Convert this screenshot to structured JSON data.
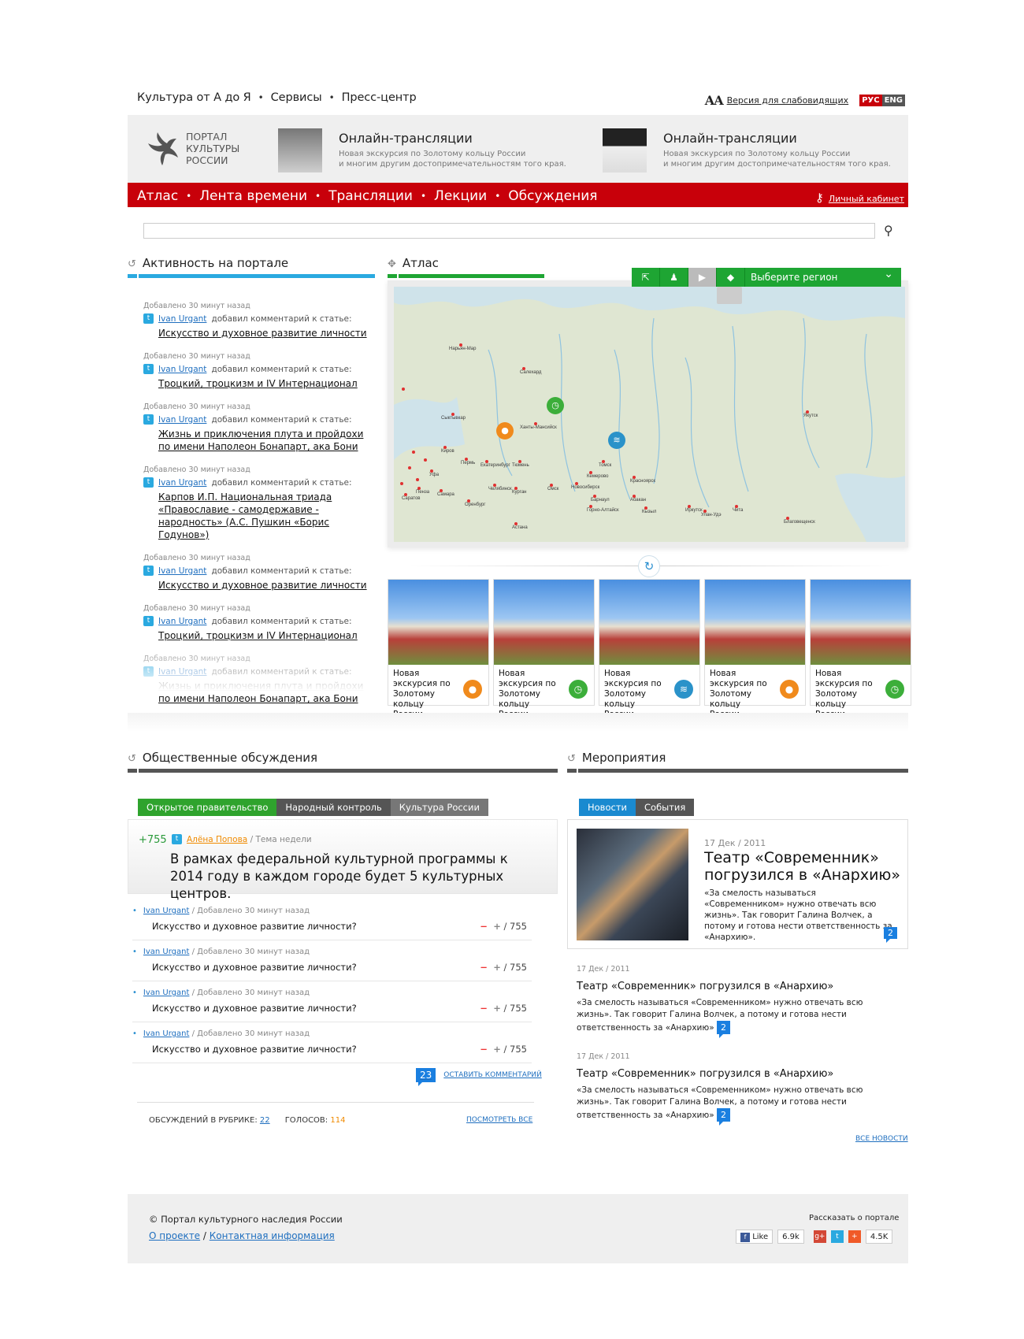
{
  "top_nav": {
    "items": [
      "Культура от А до Я",
      "Сервисы",
      "Пресс-центр"
    ]
  },
  "accessibility": {
    "aa": "AA",
    "label": "Версия для слабовидящих"
  },
  "lang": {
    "ru": "РУС",
    "en": "ENG"
  },
  "logo": {
    "line1": "ПОРТАЛ",
    "line2": "КУЛЬТУРЫ",
    "line3": "РОССИИ"
  },
  "broadcasts": [
    {
      "title": "Онлайн-трансляции",
      "desc1": "Новая экскурсия по Золотому кольцу России",
      "desc2": "и многим другим достопримечательностям того края."
    },
    {
      "title": "Онлайн-трансляции",
      "desc1": "Новая экскурсия по Золотому кольцу России",
      "desc2": "и многим другим достопримечательностям того края."
    }
  ],
  "main_nav": {
    "items": [
      "Атлас",
      "Лента времени",
      "Трансляции",
      "Лекции",
      "Обсуждения"
    ],
    "cabinet": "Личный кабинет"
  },
  "search": {
    "placeholder": ""
  },
  "activity": {
    "title": "Активность на портале",
    "items": [
      {
        "time": "Добавлено 30 минут назад",
        "user": "Ivan Urgant",
        "action": "добавил комментарий к статье:",
        "link": "Искусство и духовное развитие личности"
      },
      {
        "time": "Добавлено 30 минут назад",
        "user": "Ivan Urgant",
        "action": "добавил комментарий к статье:",
        "link": "Троцкий, троцкизм и IV Интернационал"
      },
      {
        "time": "Добавлено 30 минут назад",
        "user": "Ivan Urgant",
        "action": "добавил комментарий к статье:",
        "link": "Жизнь и приключения плута и пройдохи по имени Наполеон Бонапарт, ака Бони"
      },
      {
        "time": "Добавлено 30 минут назад",
        "user": "Ivan Urgant",
        "action": "добавил комментарий к статье:",
        "link": "Карпов И.П. Национальная триада «Православие - самодержавие - народность» (А.С. Пушкин «Борис Годунов»)"
      },
      {
        "time": "Добавлено 30 минут назад",
        "user": "Ivan Urgant",
        "action": "добавил комментарий к статье:",
        "link": "Искусство и духовное развитие личности"
      },
      {
        "time": "Добавлено 30 минут назад",
        "user": "Ivan Urgant",
        "action": "добавил комментарий к статье:",
        "link": "Троцкий, троцкизм и IV Интернационал"
      },
      {
        "time": "Добавлено 30 минут назад",
        "user": "Ivan Urgant",
        "action": "добавил комментарий к статье:",
        "link": "Жизнь и приключения плута и пройдохи по имени Наполеон Бонапарт, ака Бони"
      }
    ]
  },
  "atlas": {
    "title": "Атлас",
    "region_select": "Выберите регион",
    "cities": [
      "Салехард",
      "Нарьян-Мар",
      "Ханты-Мансийск",
      "Сыктывкар",
      "Киров",
      "Пермь",
      "Екатеринбург",
      "Тюмень",
      "Курган",
      "Челябинск",
      "Уфа",
      "Омск",
      "Новосибирск",
      "Томск",
      "Кемерово",
      "Красноярск",
      "Барнаул",
      "Горно-Алтайск",
      "Абакан",
      "Кызыл",
      "Иркутск",
      "Улан-Удэ",
      "Чита",
      "Якутск",
      "Благовещенск",
      "Самара",
      "Саратов",
      "Пенза",
      "Оренбург",
      "Астана"
    ],
    "cards": [
      {
        "text": "Новая экскурсия по Золотому кольцу России.",
        "icon": "user-icon",
        "color": "#f08a1c"
      },
      {
        "text": "Новая экскурсия по Золотому кольцу России.",
        "icon": "clock-icon",
        "color": "#3cae3a"
      },
      {
        "text": "Новая экскурсия по Золотому кольцу России.",
        "icon": "rss-icon",
        "color": "#2a92c9"
      },
      {
        "text": "Новая экскурсия по Золотому кольцу России.",
        "icon": "user-icon",
        "color": "#f08a1c"
      },
      {
        "text": "Новая экскурсия по Золотому кольцу России.",
        "icon": "clock-icon",
        "color": "#3cae3a"
      }
    ]
  },
  "discussions": {
    "title": "Общественные обсуждения",
    "tabs": [
      "Открытое правительство",
      "Народный контроль",
      "Культура России"
    ],
    "featured": {
      "plus": "+755",
      "user": "Алёна Попова",
      "tag": "Тема недели",
      "quote": "В рамках федеральной культурной программы к 2014 году в каждом городе будет 5 культурных центров."
    },
    "items": [
      {
        "user": "Ivan Urgant",
        "time": "Добавлено 30 минут назад",
        "question": "Искусство и духовное развитие личности?",
        "votes": "755"
      },
      {
        "user": "Ivan Urgant",
        "time": "Добавлено 30 минут назад",
        "question": "Искусство и духовное развитие личности?",
        "votes": "755"
      },
      {
        "user": "Ivan Urgant",
        "time": "Добавлено 30 минут назад",
        "question": "Искусство и духовное развитие личности?",
        "votes": "755"
      },
      {
        "user": "Ivan Urgant",
        "time": "Добавлено 30 минут назад",
        "question": "Искусство и духовное развитие личности?",
        "votes": "755"
      }
    ],
    "comment_count": "23",
    "leave_comment": "ОСТАВИТЬ КОММЕНТАРИЙ",
    "footer": {
      "rubric_label": "ОБСУЖДЕНИЙ В РУБРИКЕ:",
      "rubric_count": "22",
      "votes_label": "ГОЛОСОВ:",
      "votes_count": "114",
      "view_all": "ПОСМОТРЕТЬ ВСЕ"
    }
  },
  "events": {
    "title": "Мероприятия",
    "tabs": [
      "Новости",
      "События"
    ],
    "featured": {
      "date": "17 Дек / 2011",
      "title": "Театр «Современник» погрузился в «Анархию»",
      "text": "«За смелость называться «Современником» нужно отвечать всю жизнь». Так говорит Галина Волчек, а потому и готова нести ответственность за «Анархию».",
      "comments": "2"
    },
    "items": [
      {
        "date": "17 Дек / 2011",
        "title": "Театр «Современник» погрузился в «Анархию»",
        "text": "«За смелость называться «Современником» нужно отвечать всю жизнь». Так говорит Галина Волчек, а потому и готова нести ответственность за «Анархию»",
        "comments": "2"
      },
      {
        "date": "17 Дек / 2011",
        "title": "Театр «Современник» погрузился в «Анархию»",
        "text": "«За смелость называться «Современником» нужно отвечать всю жизнь». Так говорит Галина Волчек, а потому и готова нести ответственность за «Анархию»",
        "comments": "2"
      }
    ],
    "all_news": "ВСЕ НОВОСТИ"
  },
  "footer": {
    "copyright": "© Портал культурного наследия России",
    "about": "О проекте",
    "sep": "/",
    "contacts": "Контактная информация",
    "tell": "Рассказать о портале",
    "fb_like": "Like",
    "fb_count": "6.9k",
    "share_count": "4.5K"
  },
  "colors": {
    "red": "#c8000a",
    "green": "#1ea533",
    "blue": "#2aa9e0"
  }
}
